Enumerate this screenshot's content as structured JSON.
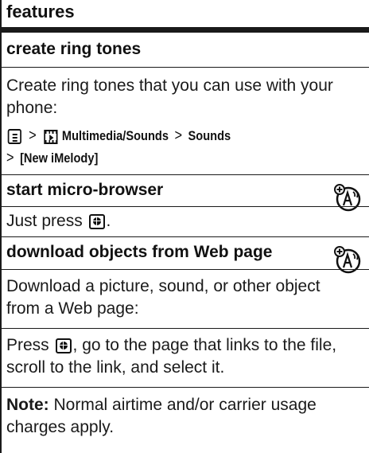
{
  "header": {
    "title": "features"
  },
  "sections": [
    {
      "title": "create ring tones",
      "body": "Create ring tones that you can use with your phone:",
      "menu_path": {
        "gt": ">",
        "item1": "Multimedia/Sounds",
        "item2": "Sounds",
        "item3": "[New iMelody]"
      }
    },
    {
      "title": "start micro-browser",
      "body_prefix": "Just press",
      "body_suffix": "."
    },
    {
      "title": "download objects from Web page",
      "body": "Download a picture, sound, or other object from a Web page:",
      "step_prefix": "Press",
      "step_suffix": ", go to the page that links to the file, scroll to the link, and select it.",
      "note_label": "Note:",
      "note_text": "Normal airtime and/or carrier usage charges apply."
    }
  ],
  "icons": {
    "menu_key": "menu-key-icon",
    "multimedia": "multimedia-icon",
    "browser_key": "browser-key-icon",
    "network_feature": "network-antenna-icon"
  }
}
